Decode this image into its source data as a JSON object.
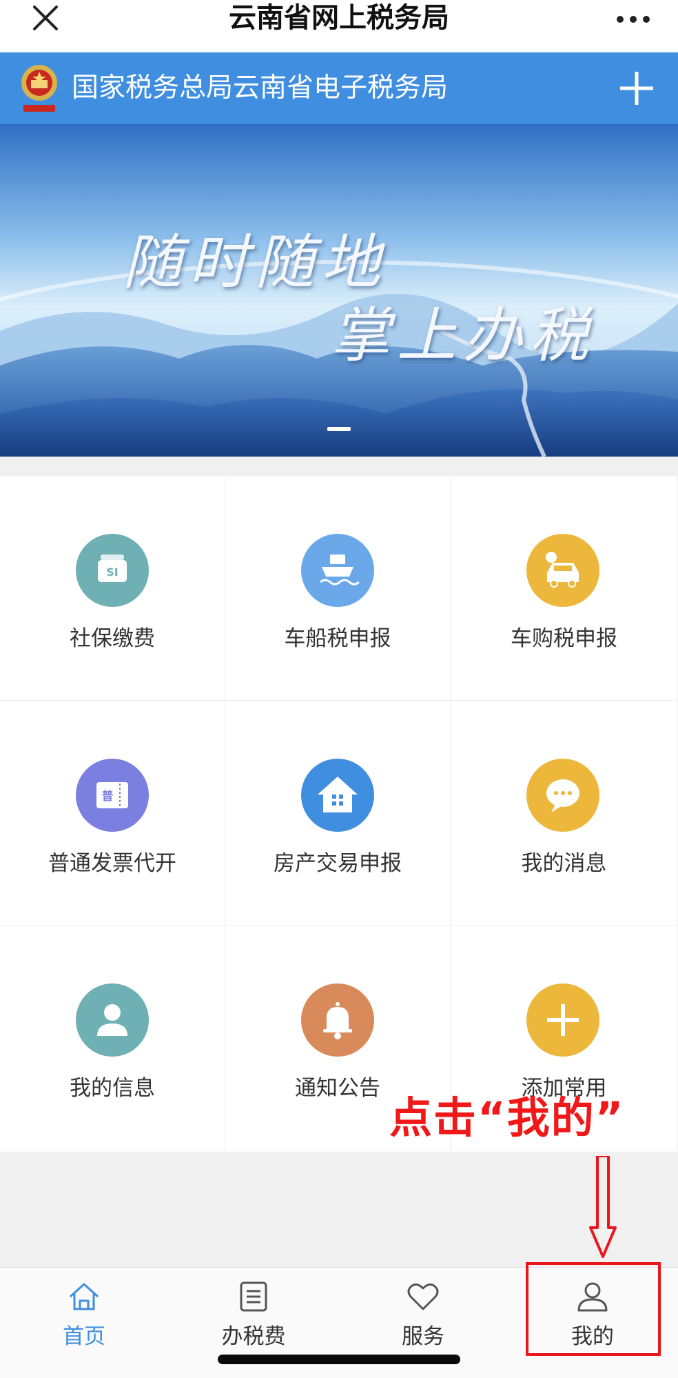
{
  "window": {
    "title": "云南省网上税务局"
  },
  "brand": {
    "name": "国家税务总局云南省电子税务局"
  },
  "banner": {
    "slogan_line1": "随时随地",
    "slogan_line2": "掌上办税"
  },
  "grid": {
    "items": [
      {
        "label": "社保缴费",
        "icon": "social-security-card-icon",
        "color": "#6fb0b4"
      },
      {
        "label": "车船税申报",
        "icon": "ship-icon",
        "color": "#6aa8ea"
      },
      {
        "label": "车购税申报",
        "icon": "car-icon",
        "color": "#ecb73a"
      },
      {
        "label": "普通发票代开",
        "icon": "invoice-ticket-icon",
        "color": "#7b80e0"
      },
      {
        "label": "房产交易申报",
        "icon": "house-icon",
        "color": "#3f8ee0"
      },
      {
        "label": "我的消息",
        "icon": "chat-bubble-icon",
        "color": "#ecb73a"
      },
      {
        "label": "我的信息",
        "icon": "user-icon",
        "color": "#6fb0b4"
      },
      {
        "label": "通知公告",
        "icon": "bell-icon",
        "color": "#d98a5a"
      },
      {
        "label": "添加常用",
        "icon": "plus-icon",
        "color": "#ecb73a"
      }
    ]
  },
  "annotation": {
    "text": "点击“我的”",
    "color": "#f01818"
  },
  "tabbar": {
    "tabs": [
      {
        "label": "首页",
        "icon": "home-icon",
        "active": true
      },
      {
        "label": "办税费",
        "icon": "list-icon",
        "active": false
      },
      {
        "label": "服务",
        "icon": "heart-icon",
        "active": false
      },
      {
        "label": "我的",
        "icon": "person-icon",
        "active": false
      }
    ]
  },
  "colors": {
    "accent": "#3f8ee0",
    "highlight": "#e8161d"
  }
}
